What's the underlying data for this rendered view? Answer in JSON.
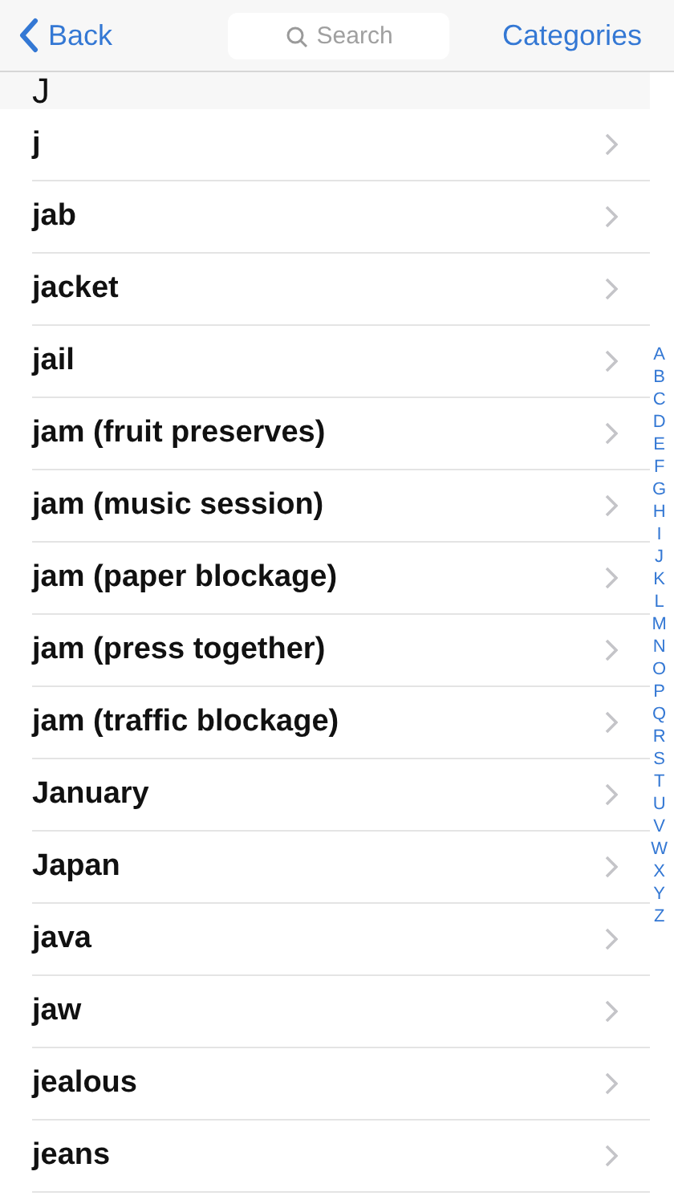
{
  "nav": {
    "back": "Back",
    "search_placeholder": "Search",
    "categories": "Categories"
  },
  "section": "J",
  "rows": [
    "j",
    "jab",
    "jacket",
    "jail",
    "jam (fruit preserves)",
    "jam (music session)",
    "jam (paper blockage)",
    "jam (press together)",
    "jam (traffic blockage)",
    "January",
    "Japan",
    "java",
    "jaw",
    "jealous",
    "jeans"
  ],
  "index": [
    "A",
    "B",
    "C",
    "D",
    "E",
    "F",
    "G",
    "H",
    "I",
    "J",
    "K",
    "L",
    "M",
    "N",
    "O",
    "P",
    "Q",
    "R",
    "S",
    "T",
    "U",
    "V",
    "W",
    "X",
    "Y",
    "Z"
  ]
}
